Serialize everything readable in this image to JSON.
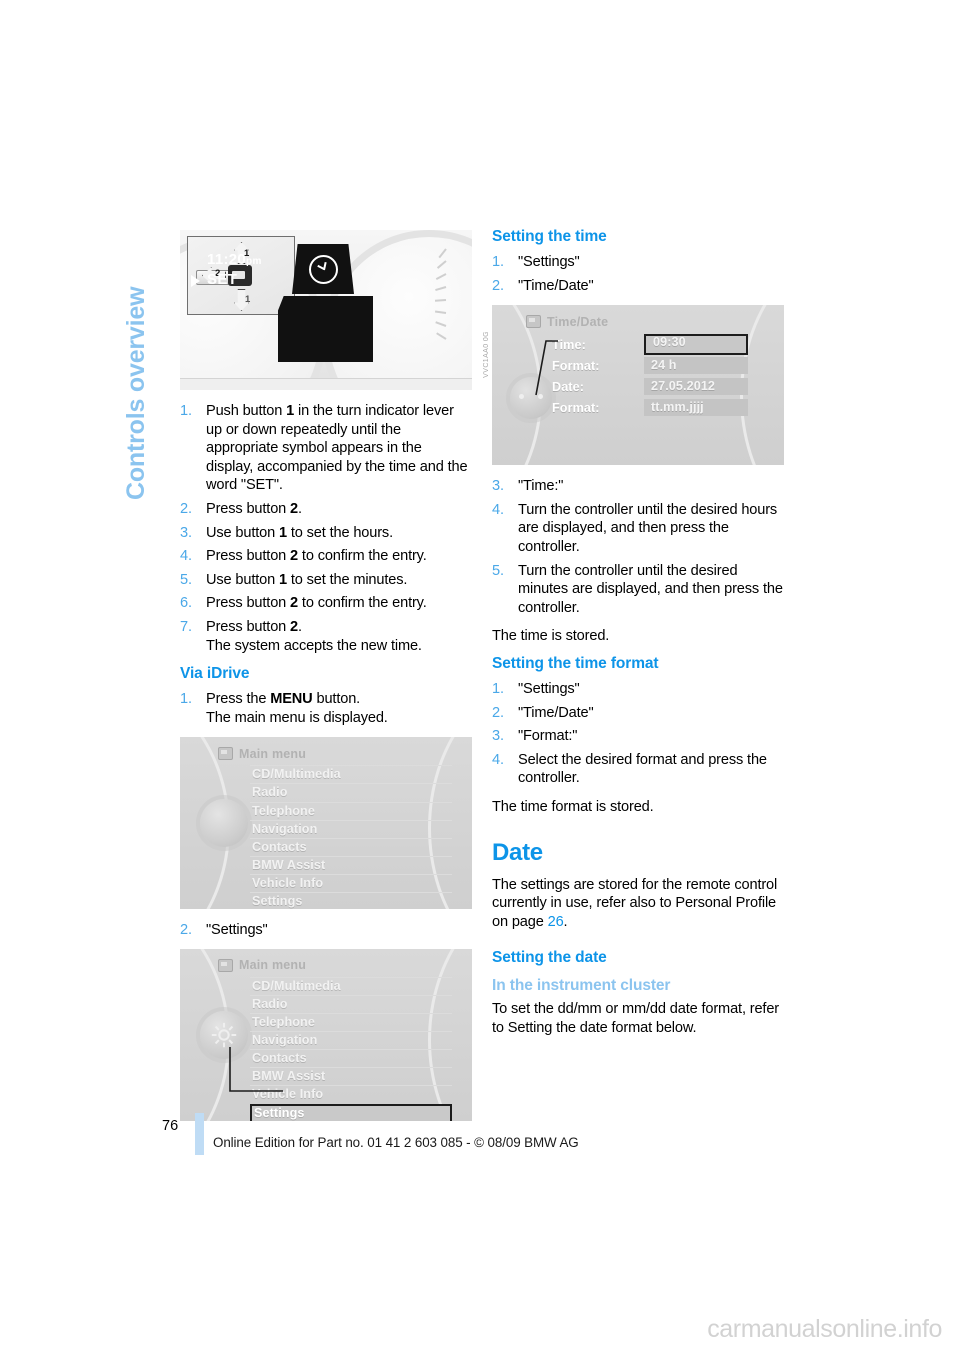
{
  "chapter_tab": "Controls overview",
  "left_column": {
    "cluster_figure": {
      "display_time": "11:20",
      "display_ampm": "pm",
      "display_set": "SET",
      "clock_icon": "clock-icon",
      "callout_1_up": "1",
      "callout_1_down": "1",
      "callout_2": "2",
      "figure_code": "VVC1AA0 0G"
    },
    "steps_cluster": [
      {
        "text_1": "Push button ",
        "bold_1": "1",
        "text_2": " in the turn indicator lever up or down repeatedly until the appropriate symbol appears in the display, accompanied by the time and the word \"SET\"."
      },
      {
        "text_1": "Press button ",
        "bold_1": "2",
        "text_2": "."
      },
      {
        "text_1": "Use button ",
        "bold_1": "1",
        "text_2": " to set the hours."
      },
      {
        "text_1": "Press button ",
        "bold_1": "2",
        "text_2": " to confirm the entry."
      },
      {
        "text_1": "Use button ",
        "bold_1": "1",
        "text_2": " to set the minutes."
      },
      {
        "text_1": "Press button ",
        "bold_1": "2",
        "text_2": " to confirm the entry."
      },
      {
        "text_1": "Press button ",
        "bold_1": "2",
        "text_2": ".",
        "line_2": "The system accepts the new time."
      }
    ],
    "via_idrive_heading": "Via iDrive",
    "via_idrive_step_1": {
      "text_1": "Press the ",
      "bold_1": "MENU",
      "text_2": " button.",
      "line_2": "The main menu is displayed."
    },
    "main_menu_figure_1": {
      "header": "Main menu",
      "header_icon": "menu-screen-icon",
      "items": [
        "CD/Multimedia",
        "Radio",
        "Telephone",
        "Navigation",
        "Contacts",
        "BMW Assist",
        "Vehicle Info",
        "Settings"
      ],
      "selected": null
    },
    "step_settings": {
      "number": "2.",
      "text": "\"Settings\""
    },
    "main_menu_figure_2": {
      "header": "Main menu",
      "header_icon": "menu-screen-icon",
      "items": [
        "CD/Multimedia",
        "Radio",
        "Telephone",
        "Navigation",
        "Contacts",
        "BMW Assist",
        "Vehicle Info",
        "Settings"
      ],
      "selected": "Settings",
      "knob_icon": "gear-icon"
    }
  },
  "right_column": {
    "setting_the_time_heading": "Setting the time",
    "time_steps_1": [
      "\"Settings\"",
      "\"Time/Date\""
    ],
    "time_date_figure": {
      "header": "Time/Date",
      "header_icon": "clock-settings-icon",
      "rows": [
        {
          "label": "Time:",
          "value": "09:30",
          "selected": true
        },
        {
          "label": "Format:",
          "value": "24 h",
          "selected": false
        },
        {
          "label": "Date:",
          "value": "27.05.2012",
          "selected": false
        },
        {
          "label": "Format:",
          "value": "tt.mm.jjjj",
          "selected": false
        }
      ]
    },
    "time_steps_2": [
      {
        "number": "3.",
        "text": "\"Time:\""
      },
      {
        "number": "4.",
        "text": "Turn the controller until the desired hours are displayed, and then press the controller."
      },
      {
        "number": "5.",
        "text": "Turn the controller until the desired minutes are displayed, and then press the controller."
      }
    ],
    "time_stored_note": "The time is stored.",
    "setting_the_time_format_heading": "Setting the time format",
    "time_format_steps": [
      "\"Settings\"",
      "\"Time/Date\"",
      "\"Format:\"",
      "Select the desired format and press the controller."
    ],
    "time_format_stored_note": "The time format is stored.",
    "date_heading": "Date",
    "date_intro_part_1": "The settings are stored for the remote control currently in use, refer also to Personal Profile on page ",
    "date_intro_pageref": "26",
    "date_intro_part_2": ".",
    "setting_the_date_heading": "Setting the date",
    "in_the_instrument_cluster_heading": "In the instrument cluster",
    "in_the_instrument_cluster_text": "To set the dd/mm or mm/dd date format, refer to Setting the date format below."
  },
  "footer": {
    "page_number": "76",
    "text": "Online Edition for Part no. 01 41 2 603 085 - © 08/09 BMW AG"
  },
  "watermark": "carmanualsonline.info",
  "colors": {
    "heading_blue": "#0d94e8",
    "light_blue": "#8bc4ef",
    "list_number_blue": "#4aa8e8",
    "footer_bar": "#bfdcf5"
  }
}
